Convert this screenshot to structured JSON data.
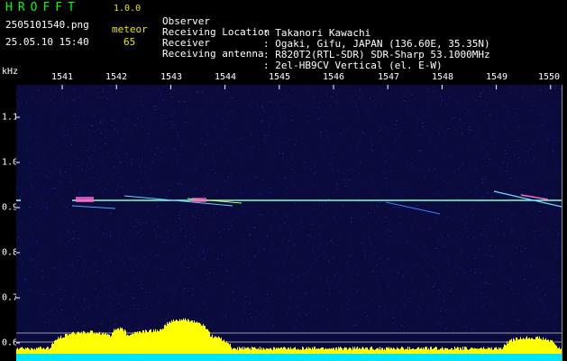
{
  "header": {
    "app_name": "HROFFT",
    "app_version": "1.0.0",
    "file_name": "2505101540.png",
    "mode_label": "meteor",
    "date_time": "25.05.10 15:40",
    "count_value": "65",
    "info": [
      {
        "key": "Observer",
        "value": ": Takanori Kawachi"
      },
      {
        "key": "Receiving Location",
        "value": ": Ogaki, Gifu, JAPAN (136.60E, 35.35N)"
      },
      {
        "key": "Receiver",
        "value": ": R820T2(RTL-SDR) SDR-Sharp 53.1000MHz"
      },
      {
        "key": "Receiving antenna",
        "value": ": 2el-HB9CV Vertical (el. E-W)"
      }
    ]
  },
  "axes": {
    "y_unit": "kHz",
    "x_ticks": [
      "1541",
      "1542",
      "1543",
      "1544",
      "1545",
      "1546",
      "1547",
      "1548",
      "1549",
      "1550"
    ],
    "y_ticks": [
      "1.1",
      "1.0",
      "0.9",
      "0.8",
      "0.7",
      "0.6"
    ],
    "y_side_label": "kHz"
  },
  "colors": {
    "background": "#0a0a3c",
    "noise": "#1a1a8a",
    "carrier": "#88ffcc",
    "meteor": "#ff66cc",
    "level": "#ffff00",
    "baseline": "#00e5ff"
  }
}
